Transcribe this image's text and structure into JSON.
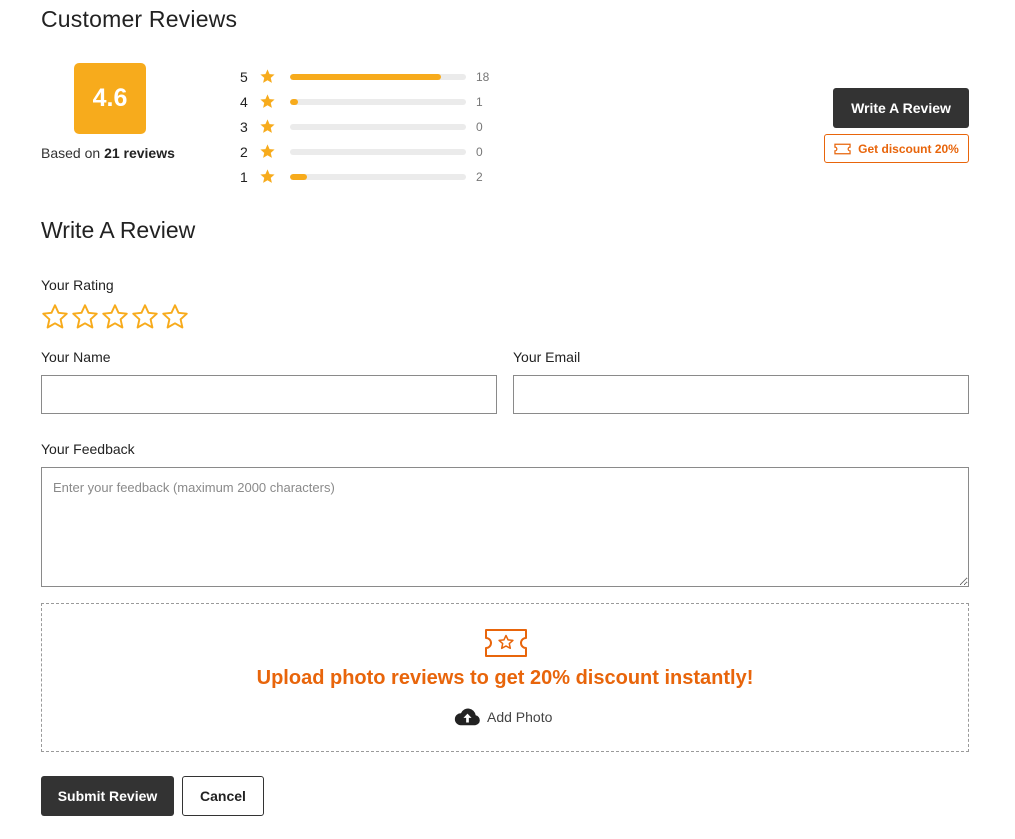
{
  "summary": {
    "title": "Customer Reviews",
    "average": "4.6",
    "based_prefix": "Based on",
    "based_count": "21 reviews",
    "distribution": [
      {
        "stars": "5",
        "count": "18",
        "fraction": 0.857
      },
      {
        "stars": "4",
        "count": "1",
        "fraction": 0.048
      },
      {
        "stars": "3",
        "count": "0",
        "fraction": 0
      },
      {
        "stars": "2",
        "count": "0",
        "fraction": 0
      },
      {
        "stars": "1",
        "count": "2",
        "fraction": 0.095
      }
    ],
    "write_review_label": "Write A Review",
    "discount_label": "Get discount 20%"
  },
  "form": {
    "title": "Write A Review",
    "rating_label": "Your Rating",
    "rating_value": 0,
    "name_label": "Your Name",
    "name_value": "",
    "email_label": "Your Email",
    "email_value": "",
    "feedback_label": "Your Feedback",
    "feedback_placeholder": "Enter your feedback (maximum 2000 characters)",
    "upload_text": "Upload photo reviews to get 20% discount instantly!",
    "add_photo_label": "Add Photo",
    "submit_label": "Submit Review",
    "cancel_label": "Cancel"
  },
  "colors": {
    "accent": "#f7ab1c",
    "discount": "#e8650b",
    "dark_button": "#333333"
  },
  "icons": {
    "star": "star-icon",
    "ticket": "ticket-icon",
    "upload": "cloud-upload-icon"
  }
}
